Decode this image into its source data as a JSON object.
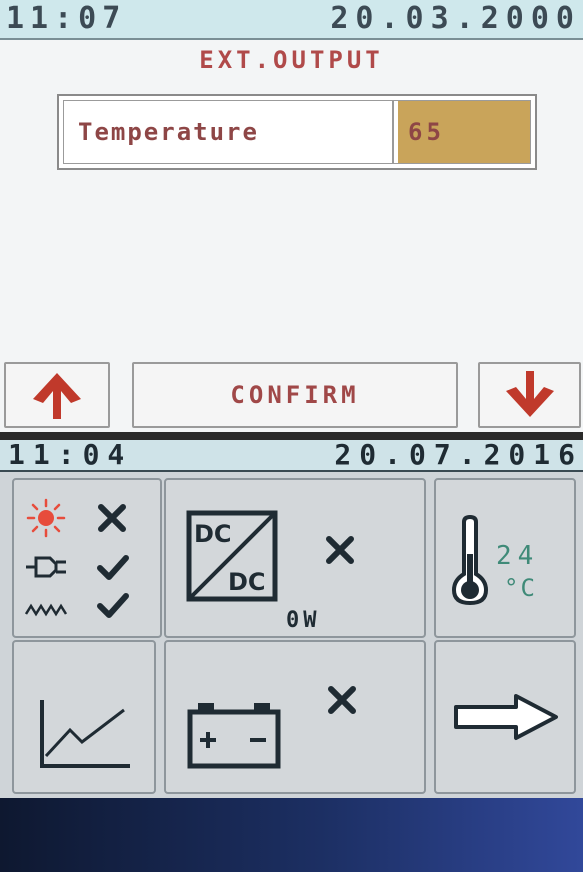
{
  "top_screen": {
    "status_bar": {
      "time": "11:07",
      "date": "20.03.2000"
    },
    "title": "EXT.OUTPUT",
    "field": {
      "label": "Temperature",
      "value": "65"
    },
    "buttons": {
      "up_icon": "arrow-up-icon",
      "confirm_label": "CONFIRM",
      "down_icon": "arrow-down-icon"
    },
    "colors": {
      "status_bg": "#cfe8ec",
      "title_text": "#b04a4a",
      "value_bg": "#c9a45a",
      "arrow": "#c0392b"
    }
  },
  "bottom_screen": {
    "status_bar": {
      "time": "11:04",
      "date": "20.07.2016"
    },
    "tiles": {
      "sources": {
        "rows": [
          {
            "icon": "sun-icon",
            "state": "unavailable",
            "state_icon": "cross-icon"
          },
          {
            "icon": "plug-icon",
            "state": "ok",
            "state_icon": "check-icon"
          },
          {
            "icon": "ac-wave-icon",
            "state": "ok",
            "state_icon": "check-icon"
          }
        ]
      },
      "converter": {
        "label_top": "DC",
        "label_bottom": "DC",
        "state_icon": "cross-icon",
        "power": "0W"
      },
      "temperature": {
        "icon": "thermometer-icon",
        "value": "24",
        "unit": "°C"
      },
      "chart": {
        "icon": "line-chart-icon"
      },
      "battery": {
        "icon": "battery-icon",
        "state_icon": "cross-icon"
      },
      "next": {
        "icon": "arrow-right-icon"
      }
    },
    "colors": {
      "status_bg": "#cfe3e8",
      "temp_text": "#3f8a78",
      "sun": "#e74c3c",
      "check": "#1f2b33"
    }
  }
}
